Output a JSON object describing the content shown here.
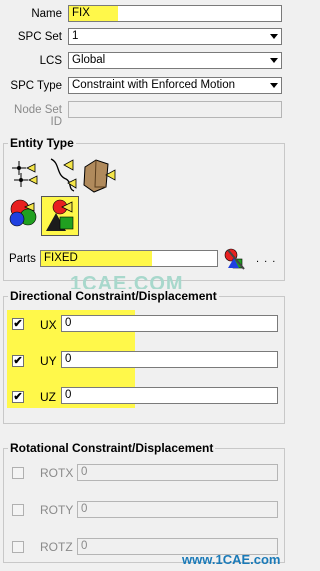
{
  "form": {
    "name_label": "Name",
    "name_value": "FIX",
    "spc_set_label": "SPC Set",
    "spc_set_value": "1",
    "lcs_label": "LCS",
    "lcs_value": "Global",
    "spc_type_label": "SPC Type",
    "spc_type_value": "Constraint with Enforced Motion",
    "node_set_label": "Node Set ID",
    "node_set_value": ""
  },
  "entity_type": {
    "title": "Entity Type",
    "icons": [
      "nodes-entity-icon",
      "curve-entity-icon",
      "surface-entity-icon",
      "part-set-entity-icon",
      "parts-entity-icon"
    ],
    "parts_label": "Parts",
    "parts_value": "FIXED",
    "more_label": ". . ."
  },
  "directional": {
    "title": "Directional Constraint/Displacement",
    "rows": [
      {
        "label": "UX",
        "value": "0",
        "checked": true
      },
      {
        "label": "UY",
        "value": "0",
        "checked": true
      },
      {
        "label": "UZ",
        "value": "0",
        "checked": true
      }
    ]
  },
  "rotational": {
    "title": "Rotational Constraint/Displacement",
    "rows": [
      {
        "label": "ROTX",
        "value": "0",
        "checked": false
      },
      {
        "label": "ROTY",
        "value": "0",
        "checked": false
      },
      {
        "label": "ROTZ",
        "value": "0",
        "checked": false
      }
    ]
  },
  "watermarks": {
    "center": "1CAE.COM",
    "footer": "www.1CAE.com"
  },
  "colors": {
    "highlight": "#fff84a",
    "background": "#f0f0f0"
  }
}
